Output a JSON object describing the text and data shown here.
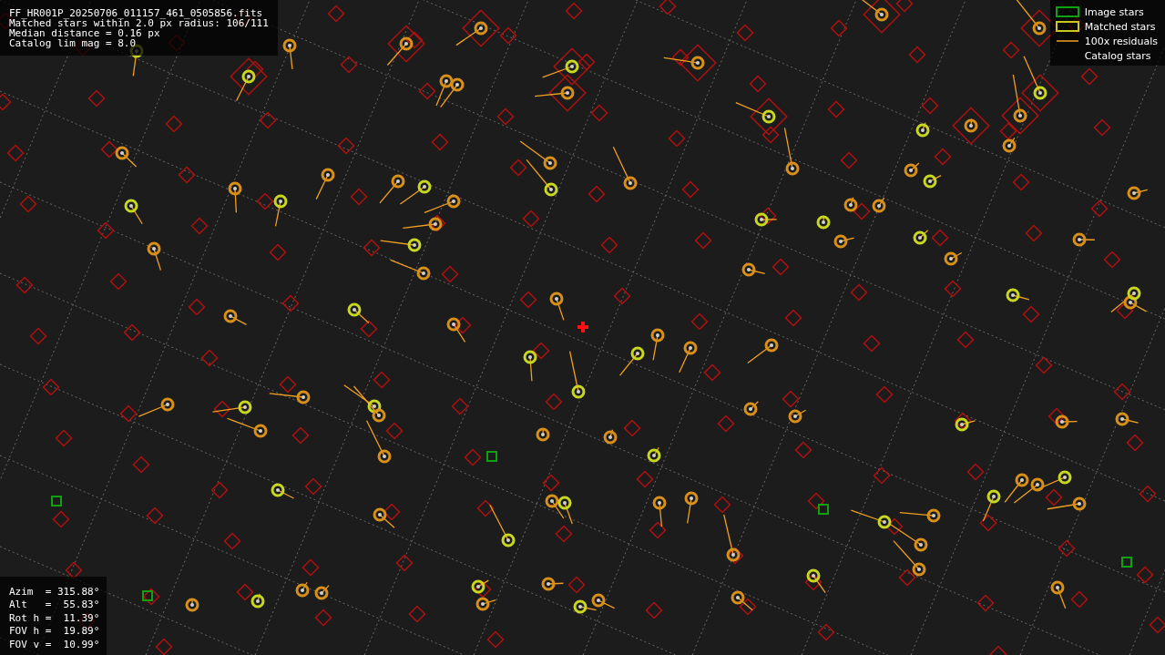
{
  "file_info": [
    "FF_HR001P_20250706_011157_461_0505856.fits",
    "Matched stars within 2.0 px radius: 106/111",
    "Median distance = 0.16 px",
    "Catalog lim mag = 8.0"
  ],
  "legend": [
    {
      "kind": "image",
      "label": "Image stars"
    },
    {
      "kind": "matched",
      "label": "Matched stars"
    },
    {
      "kind": "residual",
      "label": "100x residuals"
    },
    {
      "kind": "catalog",
      "label": "Catalog stars"
    }
  ],
  "pointing": [
    "Azim  = 315.88°",
    "Alt   =  55.83°",
    "Rot h =  11.39°",
    "FOV h =  19.89°",
    "FOV v =  10.99°"
  ]
}
